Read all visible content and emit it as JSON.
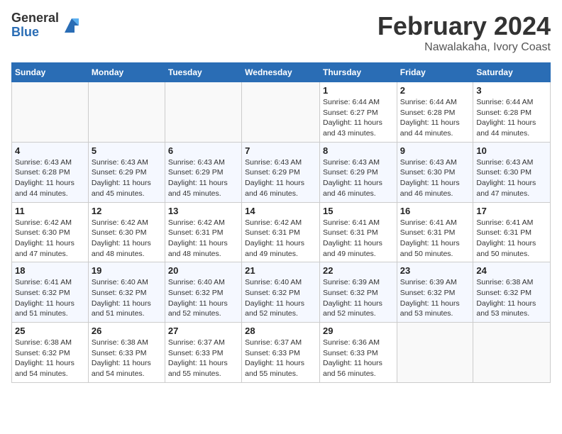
{
  "header": {
    "logo_general": "General",
    "logo_blue": "Blue",
    "title": "February 2024",
    "location": "Nawalakaha, Ivory Coast"
  },
  "weekdays": [
    "Sunday",
    "Monday",
    "Tuesday",
    "Wednesday",
    "Thursday",
    "Friday",
    "Saturday"
  ],
  "weeks": [
    [
      {
        "day": "",
        "info": ""
      },
      {
        "day": "",
        "info": ""
      },
      {
        "day": "",
        "info": ""
      },
      {
        "day": "",
        "info": ""
      },
      {
        "day": "1",
        "info": "Sunrise: 6:44 AM\nSunset: 6:27 PM\nDaylight: 11 hours\nand 43 minutes."
      },
      {
        "day": "2",
        "info": "Sunrise: 6:44 AM\nSunset: 6:28 PM\nDaylight: 11 hours\nand 44 minutes."
      },
      {
        "day": "3",
        "info": "Sunrise: 6:44 AM\nSunset: 6:28 PM\nDaylight: 11 hours\nand 44 minutes."
      }
    ],
    [
      {
        "day": "4",
        "info": "Sunrise: 6:43 AM\nSunset: 6:28 PM\nDaylight: 11 hours\nand 44 minutes."
      },
      {
        "day": "5",
        "info": "Sunrise: 6:43 AM\nSunset: 6:29 PM\nDaylight: 11 hours\nand 45 minutes."
      },
      {
        "day": "6",
        "info": "Sunrise: 6:43 AM\nSunset: 6:29 PM\nDaylight: 11 hours\nand 45 minutes."
      },
      {
        "day": "7",
        "info": "Sunrise: 6:43 AM\nSunset: 6:29 PM\nDaylight: 11 hours\nand 46 minutes."
      },
      {
        "day": "8",
        "info": "Sunrise: 6:43 AM\nSunset: 6:29 PM\nDaylight: 11 hours\nand 46 minutes."
      },
      {
        "day": "9",
        "info": "Sunrise: 6:43 AM\nSunset: 6:30 PM\nDaylight: 11 hours\nand 46 minutes."
      },
      {
        "day": "10",
        "info": "Sunrise: 6:43 AM\nSunset: 6:30 PM\nDaylight: 11 hours\nand 47 minutes."
      }
    ],
    [
      {
        "day": "11",
        "info": "Sunrise: 6:42 AM\nSunset: 6:30 PM\nDaylight: 11 hours\nand 47 minutes."
      },
      {
        "day": "12",
        "info": "Sunrise: 6:42 AM\nSunset: 6:30 PM\nDaylight: 11 hours\nand 48 minutes."
      },
      {
        "day": "13",
        "info": "Sunrise: 6:42 AM\nSunset: 6:31 PM\nDaylight: 11 hours\nand 48 minutes."
      },
      {
        "day": "14",
        "info": "Sunrise: 6:42 AM\nSunset: 6:31 PM\nDaylight: 11 hours\nand 49 minutes."
      },
      {
        "day": "15",
        "info": "Sunrise: 6:41 AM\nSunset: 6:31 PM\nDaylight: 11 hours\nand 49 minutes."
      },
      {
        "day": "16",
        "info": "Sunrise: 6:41 AM\nSunset: 6:31 PM\nDaylight: 11 hours\nand 50 minutes."
      },
      {
        "day": "17",
        "info": "Sunrise: 6:41 AM\nSunset: 6:31 PM\nDaylight: 11 hours\nand 50 minutes."
      }
    ],
    [
      {
        "day": "18",
        "info": "Sunrise: 6:41 AM\nSunset: 6:32 PM\nDaylight: 11 hours\nand 51 minutes."
      },
      {
        "day": "19",
        "info": "Sunrise: 6:40 AM\nSunset: 6:32 PM\nDaylight: 11 hours\nand 51 minutes."
      },
      {
        "day": "20",
        "info": "Sunrise: 6:40 AM\nSunset: 6:32 PM\nDaylight: 11 hours\nand 52 minutes."
      },
      {
        "day": "21",
        "info": "Sunrise: 6:40 AM\nSunset: 6:32 PM\nDaylight: 11 hours\nand 52 minutes."
      },
      {
        "day": "22",
        "info": "Sunrise: 6:39 AM\nSunset: 6:32 PM\nDaylight: 11 hours\nand 52 minutes."
      },
      {
        "day": "23",
        "info": "Sunrise: 6:39 AM\nSunset: 6:32 PM\nDaylight: 11 hours\nand 53 minutes."
      },
      {
        "day": "24",
        "info": "Sunrise: 6:38 AM\nSunset: 6:32 PM\nDaylight: 11 hours\nand 53 minutes."
      }
    ],
    [
      {
        "day": "25",
        "info": "Sunrise: 6:38 AM\nSunset: 6:32 PM\nDaylight: 11 hours\nand 54 minutes."
      },
      {
        "day": "26",
        "info": "Sunrise: 6:38 AM\nSunset: 6:33 PM\nDaylight: 11 hours\nand 54 minutes."
      },
      {
        "day": "27",
        "info": "Sunrise: 6:37 AM\nSunset: 6:33 PM\nDaylight: 11 hours\nand 55 minutes."
      },
      {
        "day": "28",
        "info": "Sunrise: 6:37 AM\nSunset: 6:33 PM\nDaylight: 11 hours\nand 55 minutes."
      },
      {
        "day": "29",
        "info": "Sunrise: 6:36 AM\nSunset: 6:33 PM\nDaylight: 11 hours\nand 56 minutes."
      },
      {
        "day": "",
        "info": ""
      },
      {
        "day": "",
        "info": ""
      }
    ]
  ]
}
